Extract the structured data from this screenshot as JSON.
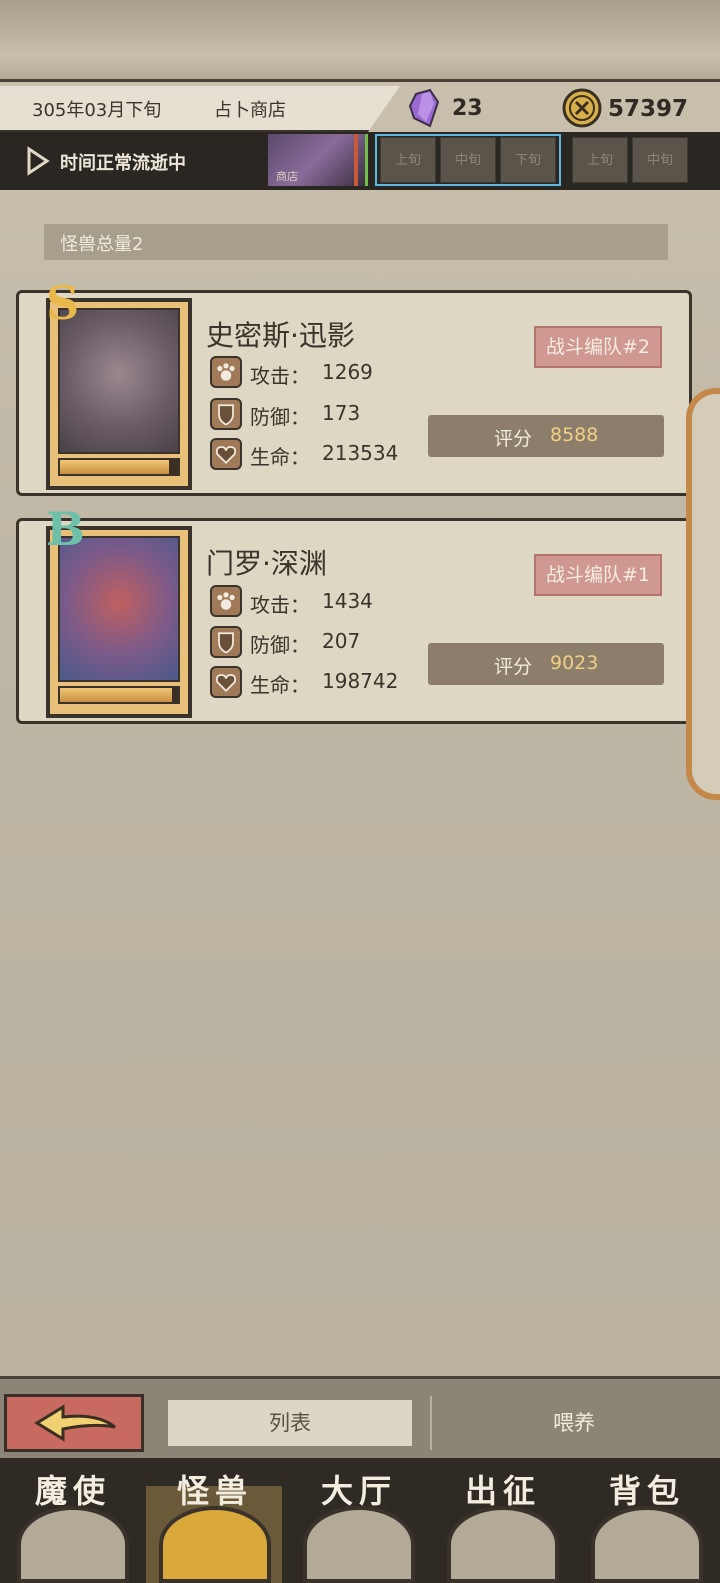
{
  "header": {
    "date": "305年03月下旬",
    "location": "占卜商店",
    "crystal_count": "23",
    "coin_count": "57397"
  },
  "time_bar": {
    "status": "时间正常流逝中",
    "shop_label": "商店",
    "periods": [
      "上旬",
      "中旬",
      "下旬",
      "上旬",
      "中旬"
    ]
  },
  "monster_total_label": "怪兽总量2",
  "monsters": [
    {
      "rank": "S",
      "name": "史密斯·迅影",
      "team": "战斗编队#2",
      "attack_label": "攻击：",
      "attack": "1269",
      "defense_label": "防御：",
      "defense": "173",
      "hp_label": "生命：",
      "hp": "213534",
      "score_label": "评分",
      "score": "8588",
      "hp_fill": 0.92
    },
    {
      "rank": "B",
      "name": "门罗·深渊",
      "team": "战斗编队#1",
      "attack_label": "攻击：",
      "attack": "1434",
      "defense_label": "防御：",
      "defense": "207",
      "hp_label": "生命：",
      "hp": "198742",
      "score_label": "评分",
      "score": "9023",
      "hp_fill": 0.95
    }
  ],
  "toolbar": {
    "list_tab": "列表",
    "feed_tab": "喂养"
  },
  "nav": [
    {
      "label": "魔使",
      "icon": "skull-icon"
    },
    {
      "label": "怪兽",
      "icon": "monster-icon"
    },
    {
      "label": "大厅",
      "icon": "hall-icon"
    },
    {
      "label": "出征",
      "icon": "expedition-icon"
    },
    {
      "label": "背包",
      "icon": "backpack-icon"
    }
  ],
  "colors": {
    "accent_gold": "#f0cf86",
    "team_badge": "#cf9890",
    "active_period_border": "#5fb8e0"
  }
}
